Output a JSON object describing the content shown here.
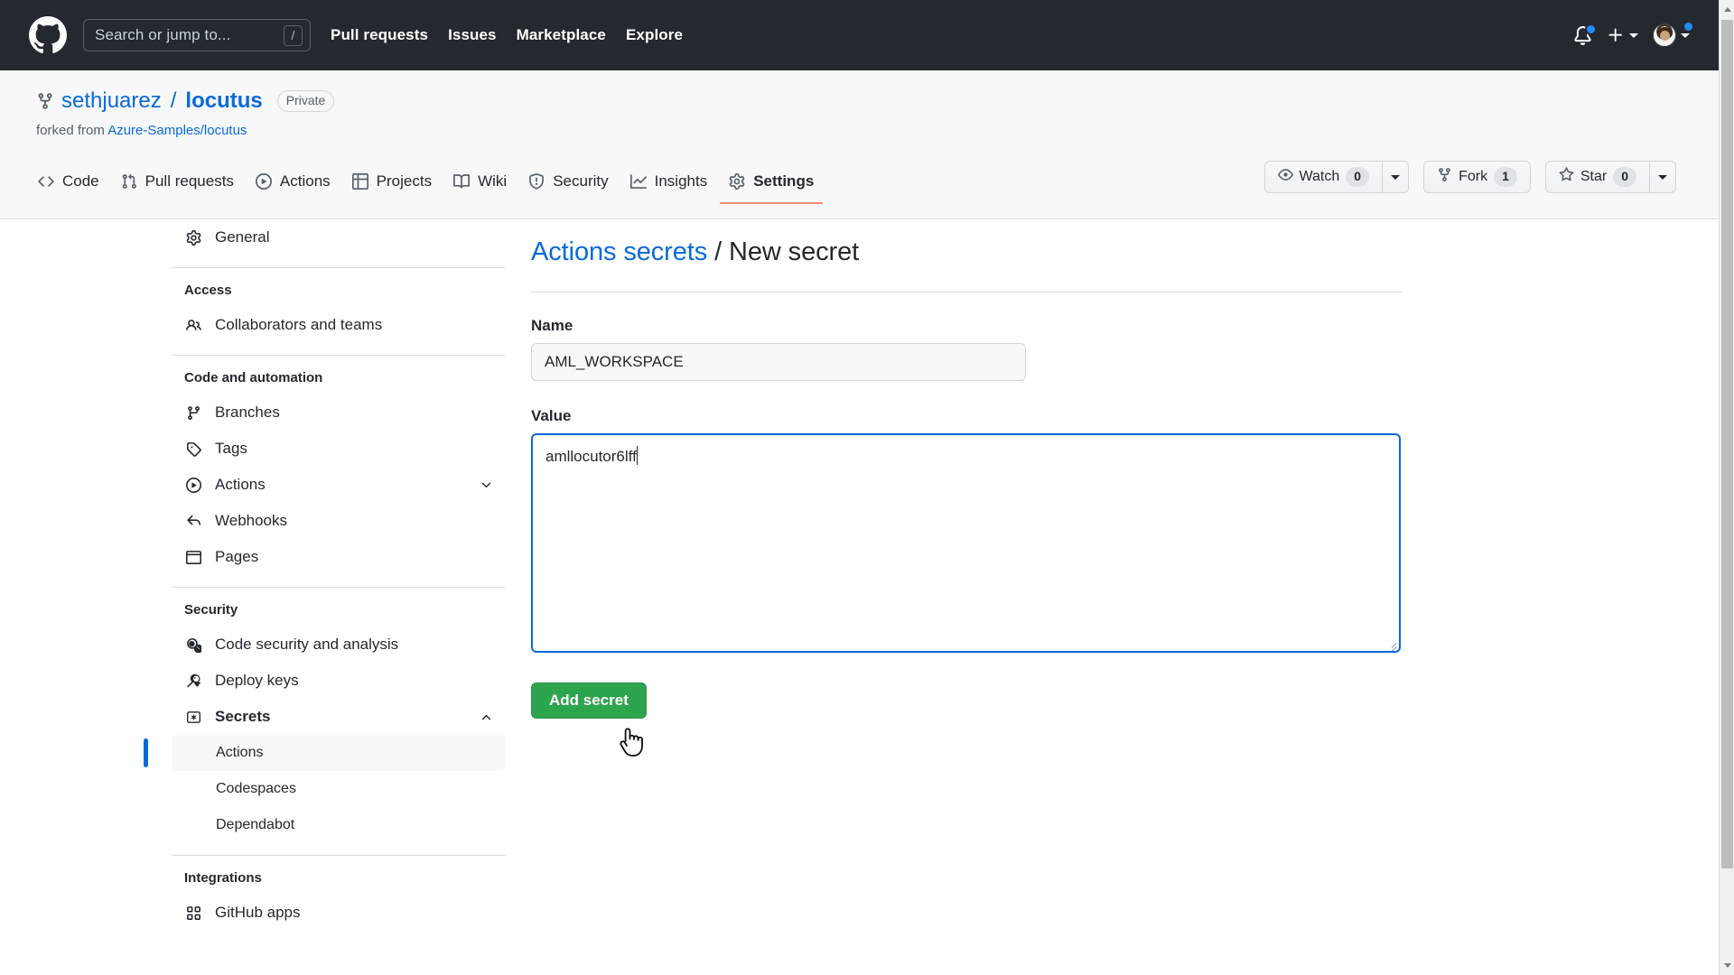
{
  "global_header": {
    "logo_icon": "github-mark-icon",
    "search": {
      "placeholder": "Search or jump to...",
      "shortcut": "/"
    },
    "nav": [
      {
        "label": "Pull requests"
      },
      {
        "label": "Issues"
      },
      {
        "label": "Marketplace"
      },
      {
        "label": "Explore"
      }
    ],
    "notifications_icon": "bell-icon",
    "create_new_icon": "plus-icon",
    "account_icon": "avatar"
  },
  "repo": {
    "fork_icon": "repo-forked-icon",
    "owner": "sethjuarez",
    "separator": "/",
    "name": "locutus",
    "visibility": "Private",
    "forked_from_prefix": "forked from",
    "forked_from": "Azure-Samples/locutus",
    "actions": {
      "watch": {
        "label": "Watch",
        "count": "0",
        "icon": "eye-icon"
      },
      "fork": {
        "label": "Fork",
        "count": "1",
        "icon": "repo-forked-icon"
      },
      "star": {
        "label": "Star",
        "count": "0",
        "icon": "star-icon"
      }
    },
    "tabs": [
      {
        "label": "Code",
        "icon": "code-icon",
        "active": false
      },
      {
        "label": "Pull requests",
        "icon": "git-pull-request-icon",
        "active": false
      },
      {
        "label": "Actions",
        "icon": "play-icon",
        "active": false
      },
      {
        "label": "Projects",
        "icon": "table-icon",
        "active": false
      },
      {
        "label": "Wiki",
        "icon": "book-icon",
        "active": false
      },
      {
        "label": "Security",
        "icon": "shield-icon",
        "active": false
      },
      {
        "label": "Insights",
        "icon": "graph-icon",
        "active": false
      },
      {
        "label": "Settings",
        "icon": "gear-icon",
        "active": true
      }
    ]
  },
  "sidebar": {
    "general": {
      "label": "General",
      "icon": "gear-icon"
    },
    "groups": [
      {
        "title": "Access",
        "items": [
          {
            "label": "Collaborators and teams",
            "icon": "people-icon"
          }
        ]
      },
      {
        "title": "Code and automation",
        "items": [
          {
            "label": "Branches",
            "icon": "git-branch-icon"
          },
          {
            "label": "Tags",
            "icon": "tag-icon"
          },
          {
            "label": "Actions",
            "icon": "play-icon",
            "chevron": "chevron-down-icon"
          },
          {
            "label": "Webhooks",
            "icon": "webhook-icon"
          },
          {
            "label": "Pages",
            "icon": "browser-icon"
          }
        ]
      },
      {
        "title": "Security",
        "items": [
          {
            "label": "Code security and analysis",
            "icon": "code-scan-icon"
          },
          {
            "label": "Deploy keys",
            "icon": "key-icon"
          },
          {
            "label": "Secrets",
            "icon": "asterisk-box-icon",
            "chevron": "chevron-up-icon",
            "bold": true
          }
        ],
        "subitems": [
          {
            "label": "Actions",
            "active": true
          },
          {
            "label": "Codespaces",
            "active": false
          },
          {
            "label": "Dependabot",
            "active": false
          }
        ]
      },
      {
        "title": "Integrations",
        "items": [
          {
            "label": "GitHub apps",
            "icon": "apps-icon"
          }
        ]
      }
    ]
  },
  "main": {
    "breadcrumb_link": "Actions secrets",
    "breadcrumb_sep": " / ",
    "breadcrumb_current": "New secret",
    "name_label": "Name",
    "name_value": "AML_WORKSPACE",
    "value_label": "Value",
    "value_text": "amllocutor6lff",
    "submit_label": "Add secret"
  },
  "colors": {
    "header_bg": "#24292f",
    "accent_link": "#0969da",
    "active_tab_underline": "#fd8c73",
    "primary_button": "#2da44e",
    "subnav_active_bar": "#0969da",
    "page_bg": "#ffffff",
    "repo_header_bg": "#f6f8fa"
  }
}
